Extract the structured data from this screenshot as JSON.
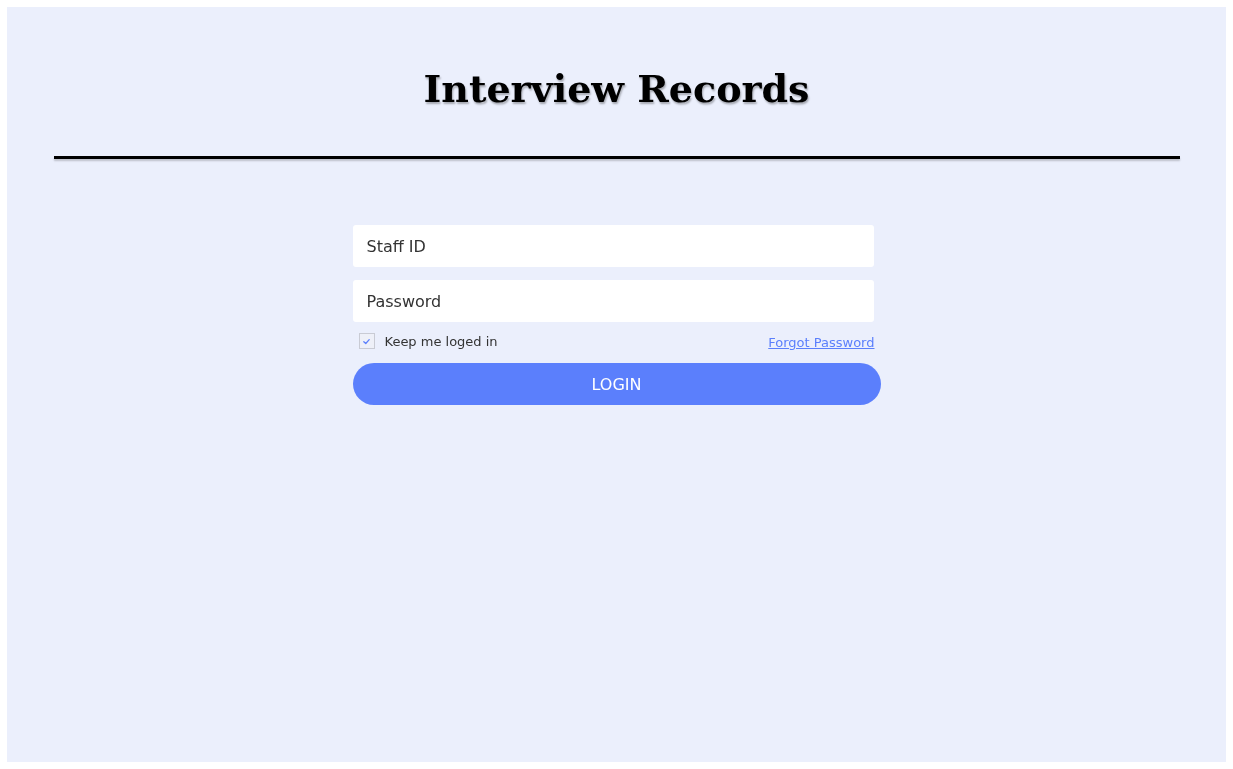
{
  "title": "Interview Records",
  "fields": [
    {
      "placeholder": "Staff ID"
    },
    {
      "placeholder": "Password"
    }
  ],
  "remember": {
    "label": "Keep me loged in",
    "checked": true
  },
  "forgot_link": "Forgot Password",
  "login_button": "LOGIN"
}
